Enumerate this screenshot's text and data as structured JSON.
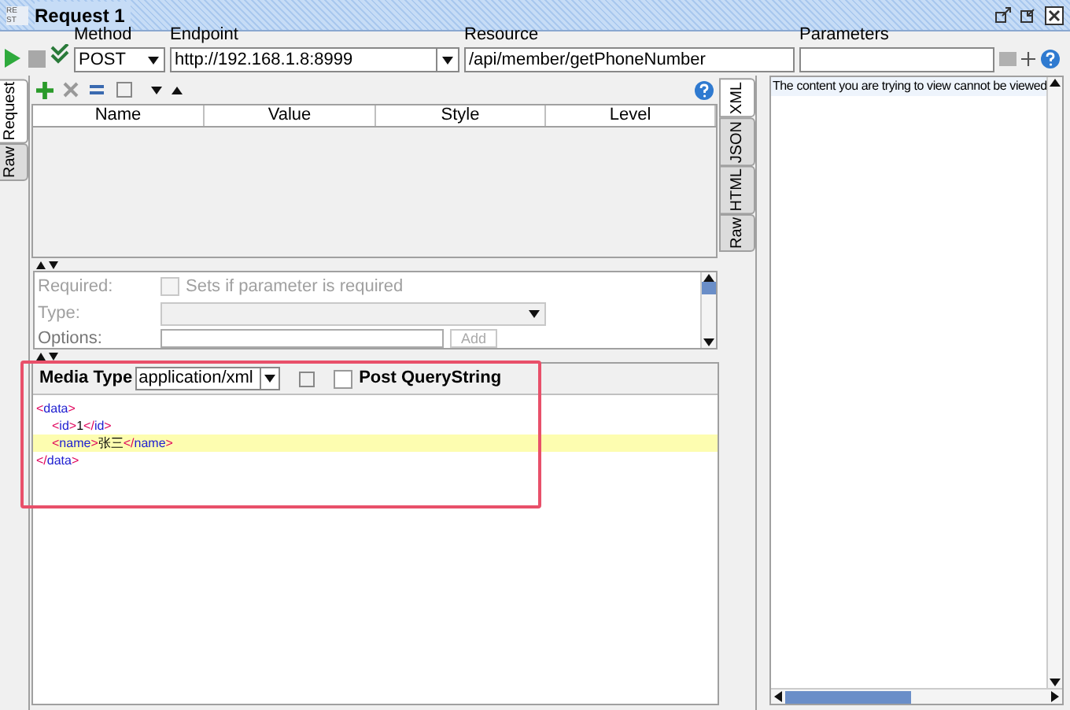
{
  "window": {
    "logo": "RE ST",
    "title": "Request 1"
  },
  "request_bar": {
    "method_label": "Method",
    "method": "POST",
    "endpoint_label": "Endpoint",
    "endpoint": "http://192.168.1.8:8999",
    "resource_label": "Resource",
    "resource": "/api/member/getPhoneNumber",
    "parameters_label": "Parameters"
  },
  "left_tabs": [
    {
      "label": "Request",
      "selected": true
    },
    {
      "label": "Raw",
      "selected": false
    }
  ],
  "table": {
    "columns": [
      "Name",
      "Value",
      "Style",
      "Level"
    ]
  },
  "param_form": {
    "required_label": "Required:",
    "required_checkbox": {
      "label": "Sets if parameter is required",
      "checked": false
    },
    "type_label": "Type:",
    "options_label": "Options:",
    "add_button": "Add"
  },
  "media": {
    "label": "Media Type",
    "value": "application/xml",
    "post_querystring": {
      "label": "Post QueryString",
      "checked": false
    }
  },
  "xml_lines": [
    {
      "indent": false,
      "highlighted": false,
      "tokens": [
        {
          "kind": "bracket",
          "text": "<"
        },
        {
          "kind": "name",
          "text": "data"
        },
        {
          "kind": "bracket",
          "text": ">"
        }
      ]
    },
    {
      "indent": true,
      "highlighted": false,
      "tokens": [
        {
          "kind": "bracket",
          "text": "<"
        },
        {
          "kind": "name",
          "text": "id"
        },
        {
          "kind": "bracket",
          "text": ">"
        },
        {
          "kind": "text",
          "text": "1"
        },
        {
          "kind": "bracket",
          "text": "</"
        },
        {
          "kind": "name",
          "text": "id"
        },
        {
          "kind": "bracket",
          "text": ">"
        }
      ]
    },
    {
      "indent": true,
      "highlighted": true,
      "tokens": [
        {
          "kind": "bracket",
          "text": "<"
        },
        {
          "kind": "name",
          "text": "name"
        },
        {
          "kind": "bracket",
          "text": ">"
        },
        {
          "kind": "text",
          "text": "张三"
        },
        {
          "kind": "bracket",
          "text": "</"
        },
        {
          "kind": "name",
          "text": "name"
        },
        {
          "kind": "bracket",
          "text": ">"
        }
      ]
    },
    {
      "indent": false,
      "highlighted": false,
      "tokens": [
        {
          "kind": "bracket",
          "text": "</"
        },
        {
          "kind": "name",
          "text": "data"
        },
        {
          "kind": "bracket",
          "text": ">"
        }
      ]
    }
  ],
  "right_tabs": [
    {
      "label": "XML",
      "selected": true
    },
    {
      "label": "JSON",
      "selected": false
    },
    {
      "label": "HTML",
      "selected": false
    },
    {
      "label": "Raw",
      "selected": false
    }
  ],
  "response": {
    "message": "The content you are trying to view cannot be viewed"
  }
}
